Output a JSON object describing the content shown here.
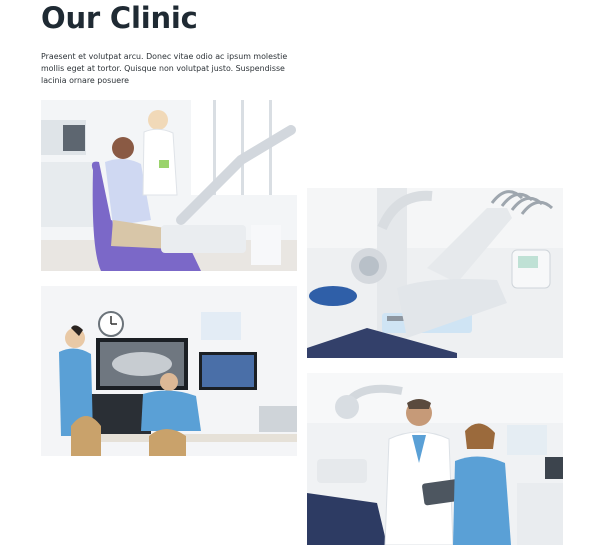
{
  "page": {
    "title": "Our Clinic",
    "intro": "Praesent et volutpat arcu. Donec vitae odio ac ipsum molestie mollis eget at tortor. Quisque non volutpat justo. Suspendisse lacinia ornare posuere"
  },
  "gallery": {
    "photos": [
      {
        "subject": "patient-in-dental-chair"
      },
      {
        "subject": "dental-unit-equipment"
      },
      {
        "subject": "doctors-reviewing-xray"
      },
      {
        "subject": "dentists-with-tablet"
      }
    ]
  },
  "colors": {
    "title": "#1f2a33",
    "text": "#2d3338",
    "scrub_blue": "#5aa0d6",
    "chair_purple": "#7b68c8"
  }
}
